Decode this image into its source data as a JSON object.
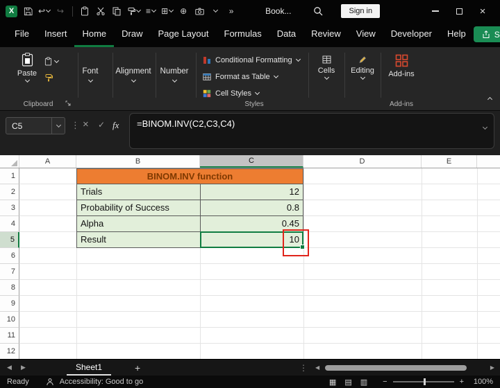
{
  "theme": {
    "accent": "#107C41",
    "share-green": "#1A8C54",
    "orange-fill": "#ED7D31",
    "orange-text": "#7F3900",
    "green-fill": "#E2EFDA",
    "annotation-red": "#E0241B"
  },
  "titlebar": {
    "workbook_name": "Book...",
    "sign_in": "Sign in"
  },
  "menubar": {
    "tabs": [
      {
        "label": "File",
        "active": false
      },
      {
        "label": "Insert",
        "active": false
      },
      {
        "label": "Home",
        "active": true
      },
      {
        "label": "Draw",
        "active": false
      },
      {
        "label": "Page Layout",
        "active": false
      },
      {
        "label": "Formulas",
        "active": false
      },
      {
        "label": "Data",
        "active": false
      },
      {
        "label": "Review",
        "active": false
      },
      {
        "label": "View",
        "active": false
      },
      {
        "label": "Developer",
        "active": false
      },
      {
        "label": "Help",
        "active": false
      }
    ],
    "share": "Share"
  },
  "ribbon": {
    "paste": "Paste",
    "clipboard_group": "Clipboard",
    "collapsed_tabs": [
      "Font",
      "Alignment",
      "Number"
    ],
    "styles": {
      "items": [
        "Conditional Formatting",
        "Format as Table",
        "Cell Styles"
      ],
      "group": "Styles"
    },
    "cells": "Cells",
    "editing": "Editing",
    "addins": "Add-ins",
    "addins_group": "Add-ins"
  },
  "formula_bar": {
    "name_box": "C5",
    "fx": "fx",
    "formula": "=BINOM.INV(C2,C3,C4)"
  },
  "grid": {
    "selected_cell": "C5",
    "columns": [
      "A",
      "B",
      "C",
      "D",
      "E"
    ],
    "rows": [
      "1",
      "2",
      "3",
      "4",
      "5",
      "6",
      "7",
      "8",
      "9",
      "10",
      "11",
      "12"
    ],
    "table": {
      "title": "BINOM.INV function",
      "rows": [
        {
          "label": "Trials",
          "value": "12"
        },
        {
          "label": "Probability of Success",
          "value": "0.8"
        },
        {
          "label": "Alpha",
          "value": "0.45"
        },
        {
          "label": "Result",
          "value": "10"
        }
      ]
    }
  },
  "sheetbar": {
    "tab": "Sheet1",
    "add": "+"
  },
  "statusbar": {
    "ready": "Ready",
    "accessibility": "Accessibility: Good to go",
    "zoom": "100%"
  },
  "glyphs": {
    "undo": "↩",
    "redo": "↪",
    "sort": "≡",
    "borders": "⊞",
    "insert": "⊕",
    "overflow": "»",
    "dots": "⋮",
    "arrow_left": "◀",
    "arrow_right": "▶",
    "view_normal": "▦",
    "view_layout": "▤",
    "view_break": "▥",
    "minus": "−",
    "plus": "+",
    "close": "×",
    "check": "✓",
    "cancel": "×",
    "app_initial": "X"
  }
}
